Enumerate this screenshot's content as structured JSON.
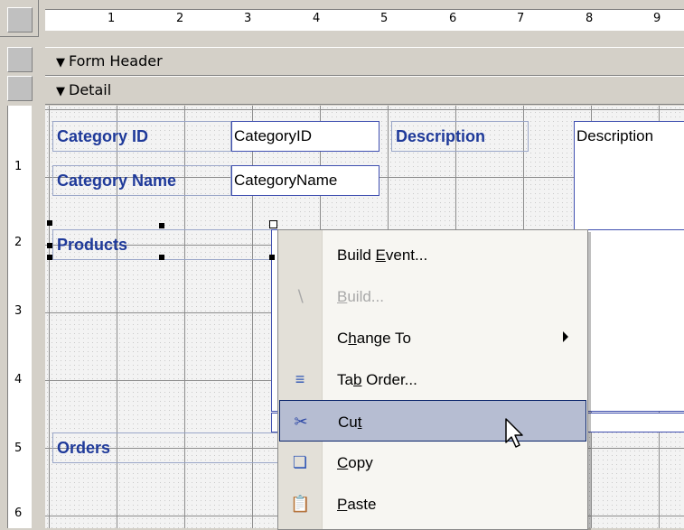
{
  "rulers": {
    "horizontal_ticks": [
      "1",
      "2",
      "3",
      "4",
      "5",
      "6",
      "7",
      "8",
      "9"
    ],
    "vertical_ticks": [
      "1",
      "2",
      "3",
      "4",
      "5",
      "6"
    ]
  },
  "sections": {
    "form_header": "Form Header",
    "detail": "Detail"
  },
  "controls": {
    "category_id_label": "Category ID",
    "category_id_field": "CategoryID",
    "description_label": "Description",
    "description_field": "Description",
    "category_name_label": "Category Name",
    "category_name_field": "CategoryName",
    "products_label": "Products",
    "orders_label": "Orders"
  },
  "context_menu": {
    "items": [
      {
        "label_before": "Build ",
        "mnemonic": "E",
        "label_after": "vent...",
        "icon": "none",
        "enabled": true
      },
      {
        "label_before": "",
        "mnemonic": "B",
        "label_after": "uild...",
        "icon": "build-wand-icon",
        "enabled": false
      },
      {
        "label_before": "C",
        "mnemonic": "h",
        "label_after": "ange To",
        "icon": "none",
        "enabled": true,
        "submenu": true
      },
      {
        "label_before": "Ta",
        "mnemonic": "b",
        "label_after": " Order...",
        "icon": "tab-order-icon",
        "enabled": true
      },
      {
        "label_before": "Cu",
        "mnemonic": "t",
        "label_after": "",
        "icon": "scissors-icon",
        "enabled": true,
        "highlighted": true
      },
      {
        "label_before": "",
        "mnemonic": "C",
        "label_after": "opy",
        "icon": "copy-icon",
        "enabled": true
      },
      {
        "label_before": "",
        "mnemonic": "P",
        "label_after": "aste",
        "icon": "paste-icon",
        "enabled": true
      }
    ]
  },
  "colors": {
    "label_text": "#1f3a9a",
    "menu_highlight": "#b6bdd2",
    "menu_highlight_border": "#0a246a"
  }
}
